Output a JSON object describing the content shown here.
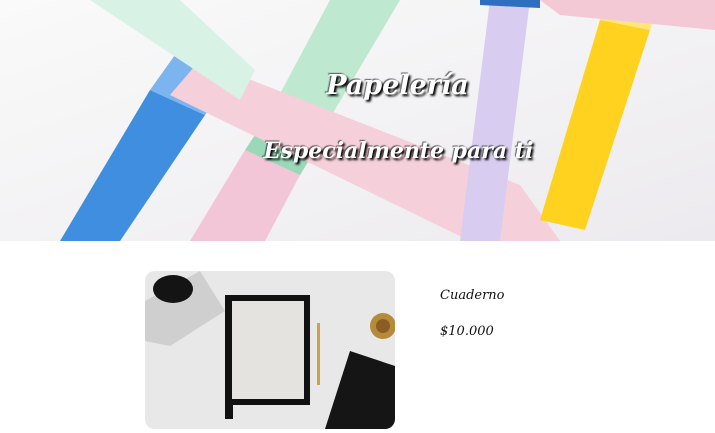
{
  "hero": {
    "title": "Papelería",
    "subtitle": "Especialmente para ti",
    "image_icon": "pastel-pens-photo"
  },
  "product": {
    "name": "Cuaderno",
    "price": "$10.000",
    "image_icon": "notebook-photo"
  }
}
